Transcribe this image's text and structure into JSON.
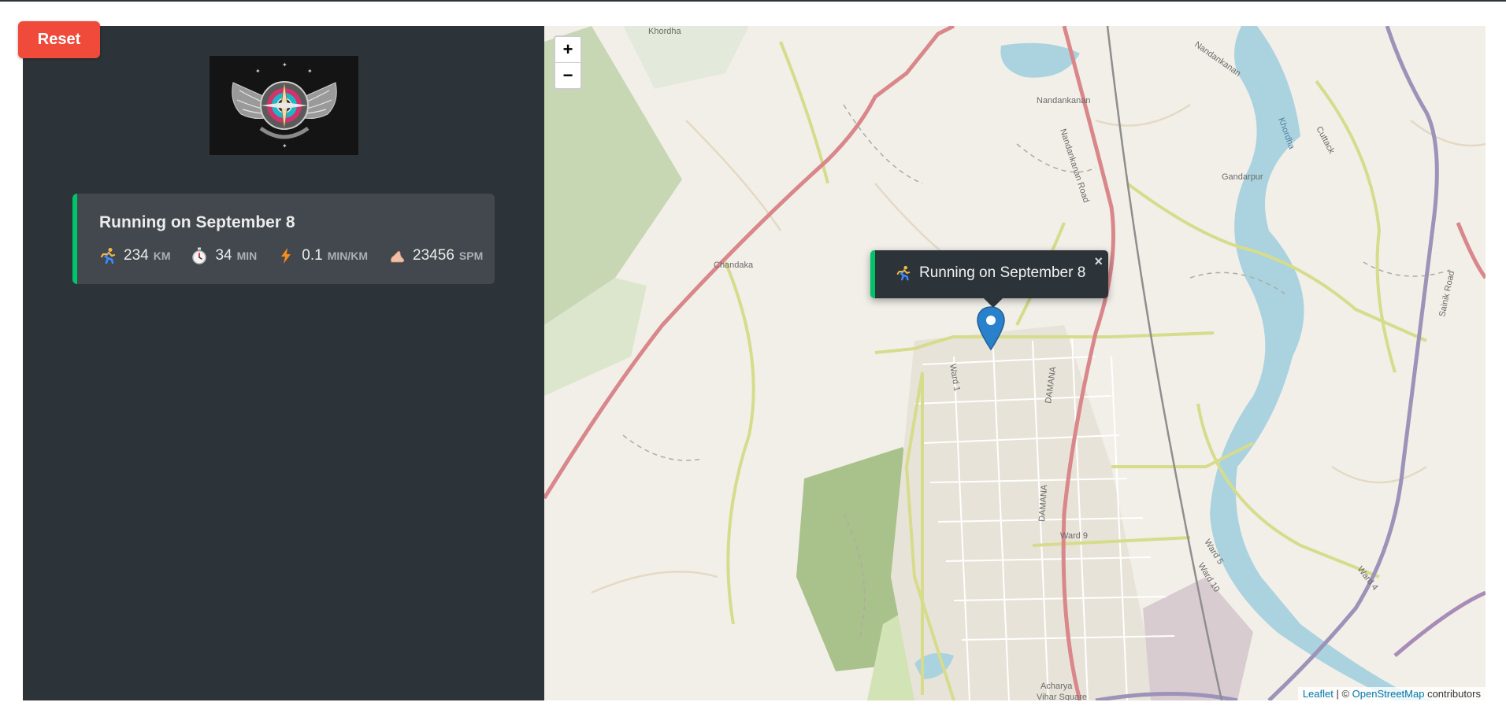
{
  "reset_label": "Reset",
  "workout": {
    "title": "Running on September 8",
    "details": [
      {
        "icon": "running-person-icon",
        "value": "234",
        "unit": "KM"
      },
      {
        "icon": "stopwatch-icon",
        "value": "34",
        "unit": "MIN"
      },
      {
        "icon": "lightning-icon",
        "value": "0.1",
        "unit": "MIN/KM"
      },
      {
        "icon": "footprint-icon",
        "value": "23456",
        "unit": "SPM"
      }
    ]
  },
  "map": {
    "zoom_in": "+",
    "zoom_out": "−",
    "popup_text": "Running on September 8",
    "popup_close": "×",
    "attribution": {
      "leaflet": "Leaflet",
      "sep": " | © ",
      "osm": "OpenStreetMap",
      "suffix": " contributors"
    },
    "labels": [
      "Khordha",
      "Nandankanan",
      "Nandankanan",
      "Nandankanan Road",
      "Khordha",
      "Cuttack",
      "Gandarpur",
      "Chandaka",
      "Ward 1",
      "DAMANA",
      "DAMANA",
      "Ward 9",
      "Ward 5",
      "Ward 10",
      "Ward 4",
      "Sainik Road",
      "Acharya",
      "Vihar Square"
    ]
  },
  "colors": {
    "accent": "#00c46a",
    "reset": "#f04a3a",
    "panel": "#2d3439",
    "card": "#42484d"
  }
}
